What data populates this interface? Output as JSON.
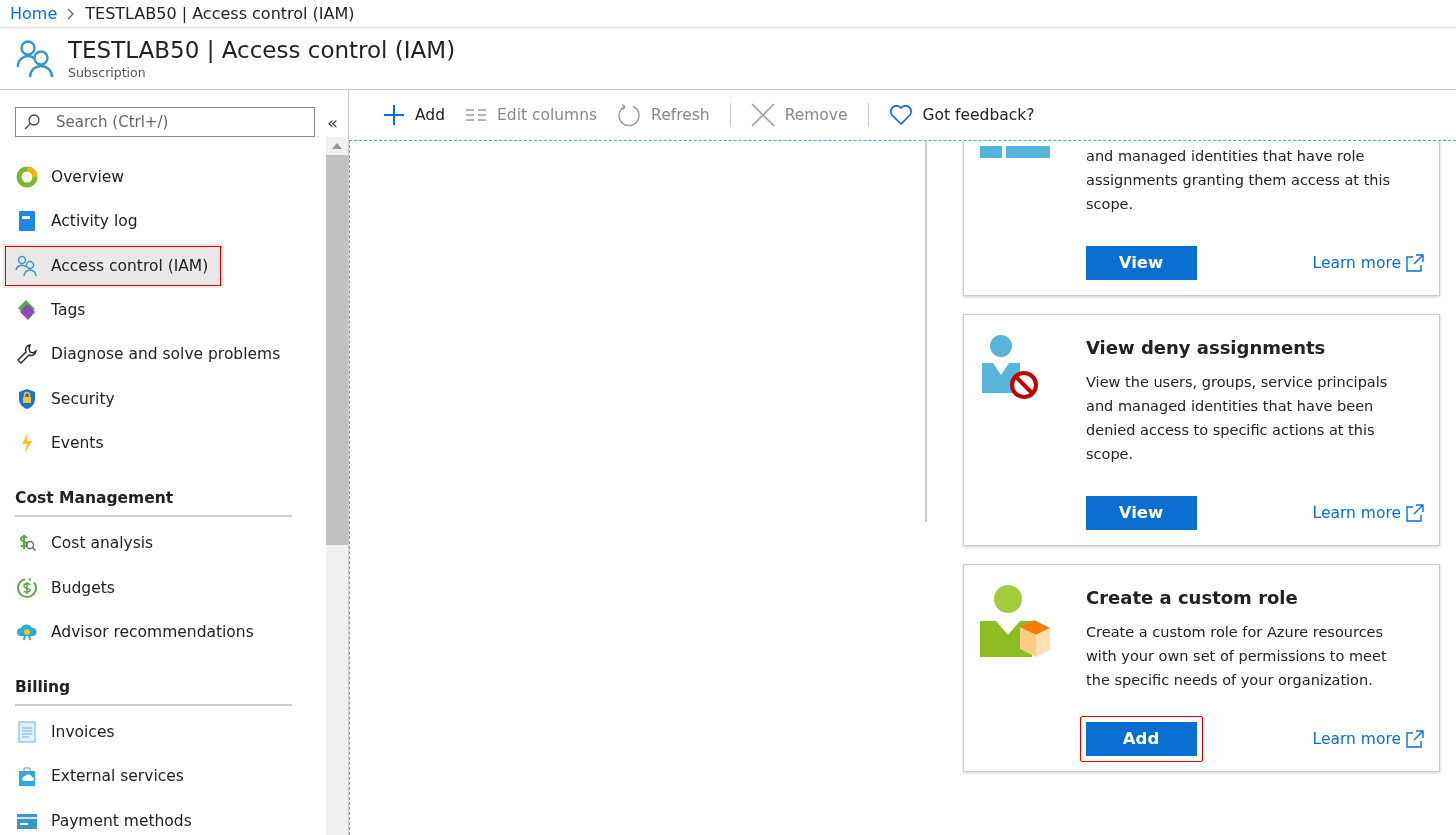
{
  "breadcrumb": [
    {
      "label": "Home",
      "kind": "link"
    },
    {
      "label": "TESTLAB50 | Access control (IAM)",
      "kind": "current"
    }
  ],
  "header": {
    "title": "TESTLAB50 | Access control (IAM)",
    "subtitle": "Subscription"
  },
  "sidebar": {
    "search": {
      "placeholder": "Search (Ctrl+/)"
    },
    "collapse": "«",
    "sections": [
      {
        "items": [
          {
            "label": "Overview",
            "selected": false,
            "outlined": false
          },
          {
            "label": "Activity log",
            "selected": false,
            "outlined": false
          },
          {
            "label": "Access control (IAM)",
            "selected": true,
            "outlined": true
          },
          {
            "label": "Tags",
            "selected": false,
            "outlined": false
          },
          {
            "label": "Diagnose and solve problems",
            "selected": false,
            "outlined": false
          },
          {
            "label": "Security",
            "selected": false,
            "outlined": false
          },
          {
            "label": "Events",
            "selected": false,
            "outlined": false
          }
        ]
      },
      {
        "heading": "Cost Management",
        "items": [
          {
            "label": "Cost analysis",
            "selected": false,
            "outlined": false
          },
          {
            "label": "Budgets",
            "selected": false,
            "outlined": false
          },
          {
            "label": "Advisor recommendations",
            "selected": false,
            "outlined": false
          }
        ]
      },
      {
        "heading": "Billing",
        "items": [
          {
            "label": "Invoices",
            "selected": false,
            "outlined": false
          },
          {
            "label": "External services",
            "selected": false,
            "outlined": false
          },
          {
            "label": "Payment methods",
            "selected": false,
            "outlined": false
          }
        ]
      }
    ]
  },
  "toolbar": [
    {
      "label": "Add",
      "disabled": false,
      "separator_after": false
    },
    {
      "label": "Edit columns",
      "disabled": true,
      "separator_after": false
    },
    {
      "label": "Refresh",
      "disabled": true,
      "separator_after": true
    },
    {
      "label": "Remove",
      "disabled": true,
      "separator_after": true
    },
    {
      "label": "Got feedback?",
      "disabled": false,
      "separator_after": false
    }
  ],
  "cards": [
    {
      "kind": "partial",
      "description": "and managed identities that have role assignments granting them access at this scope.",
      "button": {
        "label": "View",
        "outlined": false
      },
      "link": "Learn more"
    },
    {
      "kind": "full",
      "title": "View deny assignments",
      "description": "View the users, groups, service principals and managed identities that have been denied access to specific actions at this scope.",
      "button": {
        "label": "View",
        "outlined": false
      },
      "link": "Learn more"
    },
    {
      "kind": "full",
      "title": "Create a custom role",
      "description": "Create a custom role for Azure resources with your own set of permissions to meet the specific needs of your organization.",
      "button": {
        "label": "Add",
        "outlined": true
      },
      "link": "Learn more"
    }
  ]
}
